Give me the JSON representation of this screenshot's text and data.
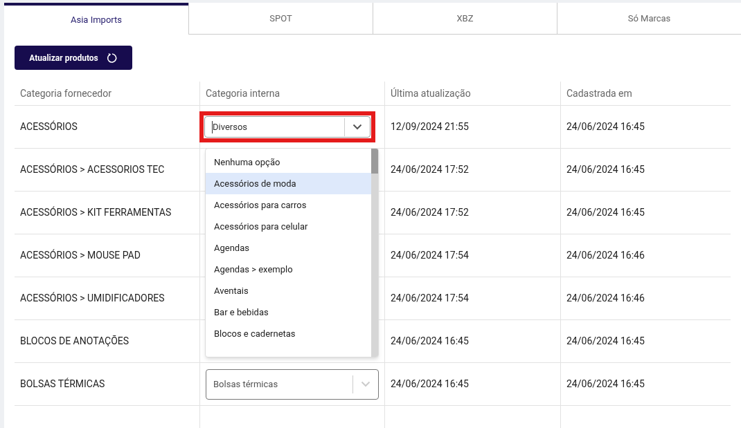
{
  "tabs": [
    {
      "label": "Asia Imports",
      "selected": true
    },
    {
      "label": "SPOT",
      "selected": false
    },
    {
      "label": "XBZ",
      "selected": false
    },
    {
      "label": "Só Marcas",
      "selected": false
    }
  ],
  "update_button": {
    "label": "Atualizar produtos"
  },
  "table": {
    "columns": [
      "Categoria fornecedor",
      "Categoria interna",
      "Última atualização",
      "Cadastrada em"
    ],
    "rows": [
      {
        "supplier_category": "ACESSÓRIOS",
        "internal_category": {
          "value": "Diversos",
          "focused": true,
          "highlighted": true
        },
        "updated": "12/09/2024 21:55",
        "created": "24/06/2024 16:45"
      },
      {
        "supplier_category": "ACESSÓRIOS > ACESSORIOS TEC",
        "updated": "24/06/2024 17:52",
        "created": "24/06/2024 16:45"
      },
      {
        "supplier_category": "ACESSÓRIOS > KIT FERRAMENTAS",
        "updated": "24/06/2024 17:52",
        "created": "24/06/2024 16:45"
      },
      {
        "supplier_category": "ACESSÓRIOS > MOUSE PAD",
        "updated": "24/06/2024 17:54",
        "created": "24/06/2024 16:46"
      },
      {
        "supplier_category": "ACESSÓRIOS > UMIDIFICADORES",
        "updated": "24/06/2024 17:54",
        "created": "24/06/2024 16:46"
      },
      {
        "supplier_category": "BLOCOS DE ANOTAÇÕES",
        "updated": "24/06/2024 16:45",
        "created": "24/06/2024 16:45"
      },
      {
        "supplier_category": "BOLSAS TÉRMICAS",
        "internal_category": {
          "value": "Bolsas térmicas",
          "focused": false,
          "highlighted": false
        },
        "updated": "24/06/2024 16:45",
        "created": "24/06/2024 16:45"
      }
    ]
  },
  "dropdown": {
    "options": [
      {
        "label": "Nenhuma opção",
        "highlighted": false
      },
      {
        "label": "Acessórios de moda",
        "highlighted": true
      },
      {
        "label": "Acessórios para carros",
        "highlighted": false
      },
      {
        "label": "Acessórios para celular",
        "highlighted": false
      },
      {
        "label": "Agendas",
        "highlighted": false
      },
      {
        "label": "Agendas > exemplo",
        "highlighted": false
      },
      {
        "label": "Aventais",
        "highlighted": false
      },
      {
        "label": "Bar e bebidas",
        "highlighted": false
      },
      {
        "label": "Blocos e cadernetas",
        "highlighted": false
      }
    ]
  }
}
